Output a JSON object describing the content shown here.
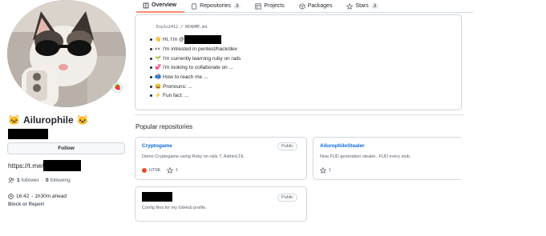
{
  "profile": {
    "name": "Ailurophile",
    "name_emoji": "🐱",
    "status_emoji": "🍓",
    "follow_label": "Follow",
    "link_prefix": "https://t.me/",
    "followers_count": "1",
    "followers_label": "follower",
    "separator": "·",
    "following_count": "0",
    "following_label": "following",
    "local_time": "16:42",
    "time_offset": "- 1h30m ahead",
    "block_label": "Block or Report"
  },
  "tabs": [
    {
      "label": "Overview",
      "icon": "book-icon",
      "count": ""
    },
    {
      "label": "Repositories",
      "icon": "repo-icon",
      "count": "3"
    },
    {
      "label": "Projects",
      "icon": "table-icon",
      "count": ""
    },
    {
      "label": "Packages",
      "icon": "package-icon",
      "count": ""
    },
    {
      "label": "Stars",
      "icon": "star-icon",
      "count": "3"
    }
  ],
  "readme": {
    "path": "Exp1o2412 / README.md",
    "items": [
      {
        "emoji": "👋",
        "text": "Hi, I'm @"
      },
      {
        "emoji": "👀",
        "text": "I'm intrested in pentest/hack/dev"
      },
      {
        "emoji": "🌱",
        "text": "I'm currently learning ruby on rails"
      },
      {
        "emoji": "💞️",
        "text": "I'm looking to collaborate on ..."
      },
      {
        "emoji": "📫",
        "text": "How to reach me ..."
      },
      {
        "emoji": "😄",
        "text": "Pronouns: ..."
      },
      {
        "emoji": "⚡",
        "text": "Fun fact: ..."
      }
    ]
  },
  "popular": {
    "title": "Popular repositories",
    "repos": [
      {
        "name": "Cryptogame",
        "visibility": "Public",
        "description": "Demo Cryptogame using Ruby on rails 7, AdminLTE",
        "language": "HTML",
        "language_color": "#e34c26",
        "stars": "1"
      },
      {
        "name": "AilurophileStealer",
        "visibility": "",
        "description": "New FUD generation stealer.. FUD every stub.",
        "language": "",
        "language_color": "",
        "stars": "1"
      },
      {
        "name": "",
        "visibility": "Public",
        "description": "Config files for my GitHub profile.",
        "language": "",
        "language_color": "",
        "stars": ""
      }
    ]
  },
  "colors": {
    "link": "#0969da",
    "tab_underline": "#fd8c73",
    "border": "#d0d7de"
  }
}
